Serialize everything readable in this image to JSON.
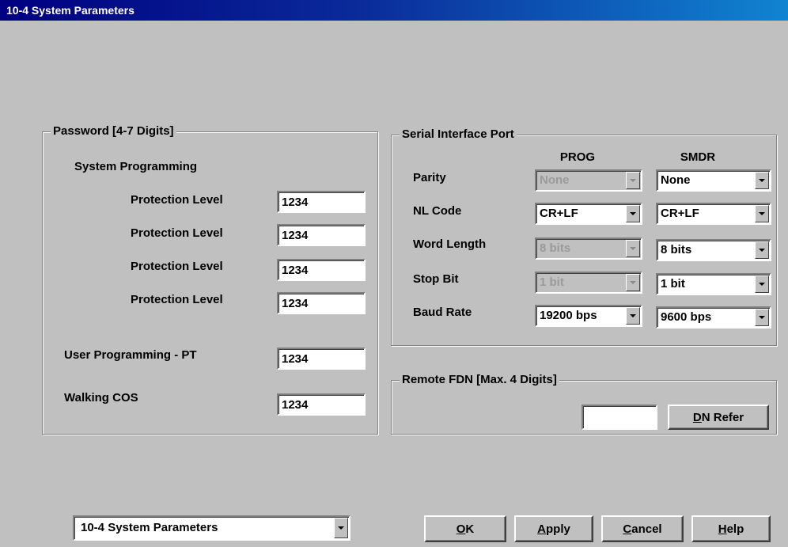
{
  "window": {
    "title": "10-4 System Parameters"
  },
  "password_group": {
    "legend": "Password [4-7 Digits]",
    "system_programming_label": "System Programming",
    "protection_rows": [
      {
        "label": "Protection Level",
        "value": "1234"
      },
      {
        "label": "Protection Level",
        "value": "1234"
      },
      {
        "label": "Protection Level",
        "value": "1234"
      },
      {
        "label": "Protection Level",
        "value": "1234"
      }
    ],
    "user_programming": {
      "label": "User Programming - PT",
      "value": "1234"
    },
    "walking_cos": {
      "label": "Walking COS",
      "value": "1234"
    }
  },
  "serial_group": {
    "legend": "Serial Interface Port",
    "col_prog": "PROG",
    "col_smdr": "SMDR",
    "rows": [
      {
        "label": "Parity",
        "prog": "None",
        "prog_enabled": false,
        "smdr": "None"
      },
      {
        "label": "NL Code",
        "prog": "CR+LF",
        "prog_enabled": true,
        "smdr": "CR+LF"
      },
      {
        "label": "Word Length",
        "prog": "8 bits",
        "prog_enabled": false,
        "smdr": "8 bits"
      },
      {
        "label": "Stop Bit",
        "prog": "1 bit",
        "prog_enabled": false,
        "smdr": "1 bit"
      },
      {
        "label": "Baud Rate",
        "prog": "19200 bps",
        "prog_enabled": true,
        "smdr": "9600 bps"
      }
    ]
  },
  "remote_fdn_group": {
    "legend": "Remote FDN [Max. 4 Digits]",
    "value": "",
    "dn_refer_prefix": "",
    "dn_refer_mnemonic": "D",
    "dn_refer_rest": "N Refer"
  },
  "footer": {
    "page_select": "10-4 System Parameters",
    "ok": {
      "mnemonic": "O",
      "rest": "K"
    },
    "apply": {
      "mnemonic": "A",
      "rest": "pply"
    },
    "cancel": {
      "mnemonic": "C",
      "rest": "ancel"
    },
    "help": {
      "mnemonic": "H",
      "rest": "elp"
    }
  },
  "colors": {
    "face": "#c0c0c0",
    "title_start": "#000080",
    "title_end": "#1084d0"
  },
  "icons": [
    "dropdown-arrow-icon"
  ]
}
